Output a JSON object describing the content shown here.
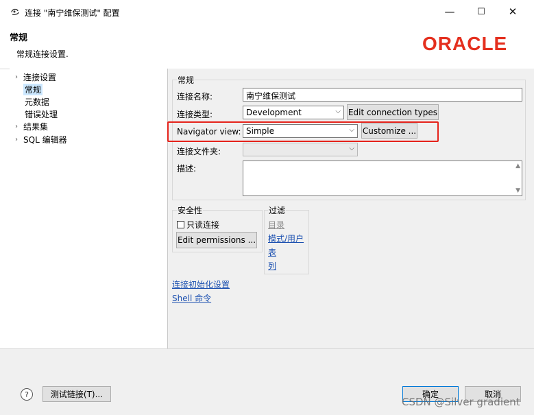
{
  "window": {
    "title": "连接 \"南宁维保测试\" 配置",
    "minimize": "—",
    "maximize": "☐",
    "close": "✕"
  },
  "header": {
    "title": "常规",
    "description": "常规连接设置.",
    "logo_text": "ORACLE"
  },
  "nav": {
    "items": [
      {
        "label": "连接设置",
        "expandable": true
      },
      {
        "label": "常规",
        "selected": true
      },
      {
        "label": "元数据"
      },
      {
        "label": "错误处理"
      },
      {
        "label": "结果集",
        "expandable": true
      },
      {
        "label": "SQL 编辑器",
        "expandable": true
      }
    ]
  },
  "general": {
    "section_title": "常规",
    "connection_name_label": "连接名称:",
    "connection_name_value": "南宁维保测试",
    "connection_type_label": "连接类型:",
    "connection_type_value": "Development",
    "edit_types_button": "Edit connection types",
    "navigator_label": "Navigator view:",
    "navigator_value": "Simple",
    "customize_button": "Customize ...",
    "folder_label": "连接文件夹:",
    "folder_value": "",
    "description_label": "描述:"
  },
  "security": {
    "title": "安全性",
    "readonly_label": "只读连接",
    "edit_permissions_button": "Edit permissions ..."
  },
  "filter": {
    "title": "过滤",
    "links": [
      "目录",
      "模式/用户",
      "表",
      "列"
    ]
  },
  "links": {
    "init_settings": "连接初始化设置",
    "shell_commands": "Shell 命令"
  },
  "footer": {
    "help": "?",
    "test_button": "测试链接(T)...",
    "ok_button": "确定",
    "cancel_button": "取消",
    "watermark": "CSDN @Silver gradient"
  },
  "colors": {
    "highlight": "#e5221a",
    "oracle_red": "#e42f1e",
    "link": "#1a4fb0"
  }
}
